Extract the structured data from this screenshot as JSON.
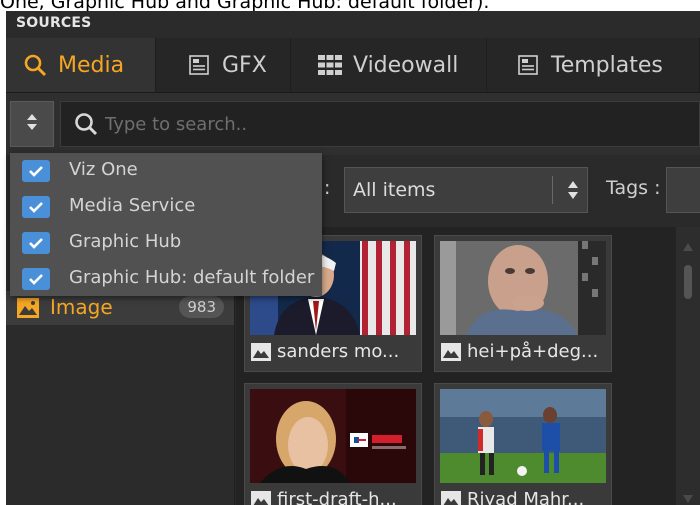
{
  "caption": "One, Graphic Hub and Graphic Hub: default folder).",
  "panel": {
    "title": "SOURCES"
  },
  "tabs": [
    {
      "label": "Media",
      "icon": "search-icon",
      "active": true
    },
    {
      "label": "GFX",
      "icon": "gfx-icon",
      "active": false
    },
    {
      "label": "Videowall",
      "icon": "videowall-icon",
      "active": false
    },
    {
      "label": "Templates",
      "icon": "templates-icon",
      "active": false
    }
  ],
  "search": {
    "placeholder": "Type to search.."
  },
  "filter": {
    "colon": ":",
    "selected": "All items",
    "tags_label": "Tags :"
  },
  "sources_dropdown": {
    "items": [
      {
        "label": "Viz One",
        "checked": true
      },
      {
        "label": "Media Service",
        "checked": true
      },
      {
        "label": "Graphic Hub",
        "checked": true
      },
      {
        "label": "Graphic Hub: default folder",
        "checked": true
      }
    ]
  },
  "categories": [
    {
      "label": "Image",
      "count": "983",
      "icon": "image-icon"
    }
  ],
  "media_items": [
    {
      "title": "sanders mo...",
      "icon": "image-icon"
    },
    {
      "title": "hei+på+deg...",
      "icon": "image-icon"
    },
    {
      "title": "first-draft-h...",
      "icon": "image-icon"
    },
    {
      "title": "Riyad Mahr...",
      "icon": "image-icon"
    }
  ],
  "colors": {
    "accent": "#f5a623",
    "checkbox": "#4a90d9",
    "panel_bg": "#2b2b2b"
  }
}
